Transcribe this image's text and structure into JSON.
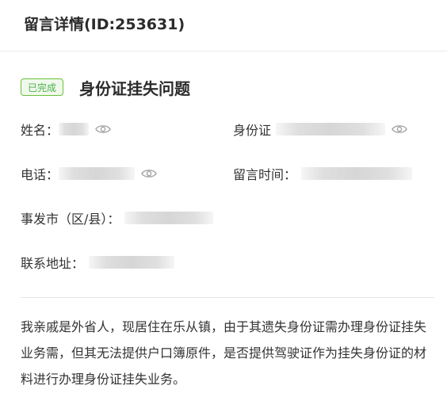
{
  "header": {
    "title": "留言详情(ID:253631)"
  },
  "issue": {
    "status_badge": "已完成",
    "title": "身份证挂失问题"
  },
  "fields": {
    "name_label": "姓名：",
    "id_card_label": "身份证",
    "phone_label": "电话：",
    "message_time_label": "留言时间：",
    "incident_location_label": "事发市（区/县）：",
    "address_label": "联系地址："
  },
  "description": "我亲戚是外省人，现居住在乐从镇，由于其遗失身份证需办理身份证挂失业务需，但其无法提供户口簿原件，是否提供驾驶证作为挂失身份证的材料进行办理身份证挂失业务。",
  "icons": {
    "reveal": "eye-icon"
  },
  "colors": {
    "badge_border": "#67c23a",
    "badge_text": "#4caf50",
    "badge_bg": "#f0f9eb"
  }
}
